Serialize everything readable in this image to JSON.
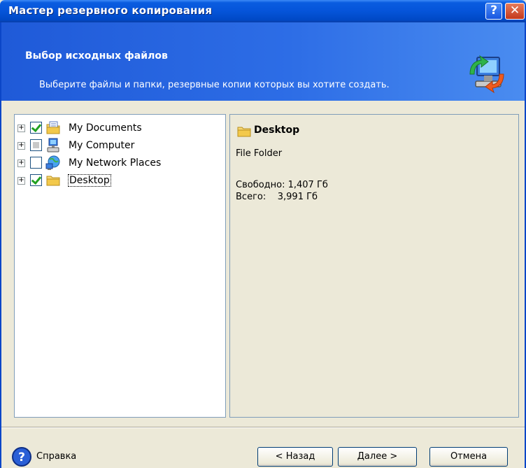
{
  "window": {
    "title": "Мастер резервного копирования",
    "help_button": "?",
    "close_button": "✕"
  },
  "header": {
    "title": "Выбор исходных файлов",
    "subtitle": "Выберите файлы и папки, резервные копии которых вы хотите создать."
  },
  "tree": {
    "items": [
      {
        "label": "My Documents",
        "expander": "+",
        "check": "checked",
        "icon": "my-documents-icon"
      },
      {
        "label": "My Computer",
        "expander": "+",
        "check": "partial",
        "icon": "my-computer-icon"
      },
      {
        "label": "My Network Places",
        "expander": "+",
        "check": "unchecked",
        "icon": "network-places-icon"
      },
      {
        "label": "Desktop",
        "expander": "+",
        "check": "checked",
        "icon": "folder-icon",
        "selected": true
      }
    ]
  },
  "details": {
    "title": "Desktop",
    "type": "File Folder",
    "free": "Свободно: 1,407 Гб",
    "total": "Всего:    3,991 Гб"
  },
  "footer": {
    "help": "Справка",
    "back": "< Назад",
    "next": "Далее >",
    "cancel": "Отмена"
  },
  "colors": {
    "titlebar": "#0554d9",
    "header": "#2d6de6",
    "face": "#ece9d8",
    "check": "#21a121"
  }
}
